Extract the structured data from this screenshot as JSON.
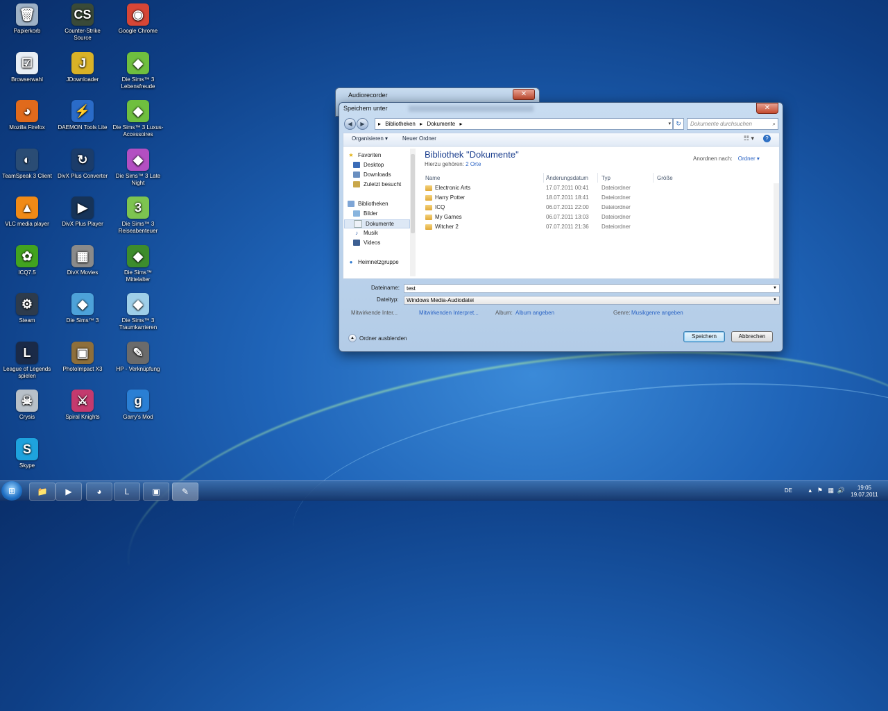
{
  "desktop": {
    "icons": [
      {
        "label": "Papierkorb",
        "icon": "recycle-bin-icon",
        "color": "#9fb2c6",
        "glyph": "🗑"
      },
      {
        "label": "Counter-Strike Source",
        "icon": "counter-strike-icon",
        "color": "#3a4a38",
        "glyph": "CS"
      },
      {
        "label": "Google Chrome",
        "icon": "chrome-icon",
        "color": "#d64636",
        "glyph": "◉"
      },
      {
        "label": "Browserwahl",
        "icon": "browser-choice-icon",
        "color": "#e8eef5",
        "glyph": "☑"
      },
      {
        "label": "JDownloader",
        "icon": "jdownloader-icon",
        "color": "#d9b227",
        "glyph": "J"
      },
      {
        "label": "Die Sims™ 3 Lebensfreude",
        "icon": "sims-icon",
        "color": "#6fbf3f",
        "glyph": "◆"
      },
      {
        "label": "Mozilla Firefox",
        "icon": "firefox-icon",
        "color": "#e06a1c",
        "glyph": "◕"
      },
      {
        "label": "DAEMON Tools Lite",
        "icon": "daemon-tools-icon",
        "color": "#2a6bc8",
        "glyph": "⚡"
      },
      {
        "label": "Die Sims™ 3 Luxus-Accessoires",
        "icon": "sims-icon",
        "color": "#6fbf3f",
        "glyph": "◆"
      },
      {
        "label": "TeamSpeak 3 Client",
        "icon": "teamspeak-icon",
        "color": "#2a4c74",
        "glyph": "◐"
      },
      {
        "label": "DivX Plus Converter",
        "icon": "divx-converter-icon",
        "color": "#1b3c6a",
        "glyph": "↻"
      },
      {
        "label": "Die Sims™ 3 Late Night",
        "icon": "sims-icon",
        "color": "#b34fc2",
        "glyph": "◆"
      },
      {
        "label": "VLC media player",
        "icon": "vlc-icon",
        "color": "#f08a16",
        "glyph": "▲"
      },
      {
        "label": "DivX Plus Player",
        "icon": "divx-player-icon",
        "color": "#163358",
        "glyph": "▶"
      },
      {
        "label": "Die Sims™ 3 Reiseabenteuer",
        "icon": "sims-icon",
        "color": "#7dc450",
        "glyph": "3"
      },
      {
        "label": "ICQ7.5",
        "icon": "icq-icon",
        "color": "#42a31f",
        "glyph": "✿"
      },
      {
        "label": "DivX Movies",
        "icon": "divx-movies-icon",
        "color": "#8a8a8a",
        "glyph": "▦"
      },
      {
        "label": "Die Sims™ Mittelalter",
        "icon": "sims-icon",
        "color": "#3d8c2c",
        "glyph": "◆"
      },
      {
        "label": "Steam",
        "icon": "steam-icon",
        "color": "#2d3b4c",
        "glyph": "⚙"
      },
      {
        "label": "Die Sims™ 3",
        "icon": "sims-icon",
        "color": "#4da2d9",
        "glyph": "◆"
      },
      {
        "label": "Die Sims™ 3 Traumkarrieren",
        "icon": "sims-icon",
        "color": "#9ecfe8",
        "glyph": "◆"
      },
      {
        "label": "League of Legends spielen",
        "icon": "league-of-legends-icon",
        "color": "#1a2a48",
        "glyph": "L"
      },
      {
        "label": "PhotoImpact X3",
        "icon": "photoimpact-icon",
        "color": "#8e6f3b",
        "glyph": "▣"
      },
      {
        "label": "HP - Verknüpfung",
        "icon": "hp-shortcut-icon",
        "color": "#6b6b6b",
        "glyph": "✎"
      },
      {
        "label": "Crysis",
        "icon": "crysis-icon",
        "color": "#b8c0c8",
        "glyph": "☠"
      },
      {
        "label": "Spiral Knights",
        "icon": "spiral-knights-icon",
        "color": "#c43a6e",
        "glyph": "⚔"
      },
      {
        "label": "Garry's Mod",
        "icon": "garrys-mod-icon",
        "color": "#2a7fd4",
        "glyph": "g"
      },
      {
        "label": "Skype",
        "icon": "skype-icon",
        "color": "#1ea2dd",
        "glyph": "S"
      }
    ]
  },
  "bg_window": {
    "title": "Audiorecorder",
    "close": "✕"
  },
  "dialog": {
    "title": "Speichern unter",
    "close": "✕",
    "breadcrumb": [
      "Bibliotheken",
      "Dokumente"
    ],
    "search_placeholder": "Dokumente durchsuchen",
    "toolbar": {
      "organize": "Organisieren ▾",
      "new_folder": "Neuer Ordner"
    },
    "nav": {
      "favorites_header": "Favoriten",
      "favorites": [
        "Desktop",
        "Downloads",
        "Zuletzt besucht"
      ],
      "libraries_header": "Bibliotheken",
      "libraries": [
        "Bilder",
        "Dokumente",
        "Musik",
        "Videos"
      ],
      "homegroup": "Heimnetzgruppe"
    },
    "library": {
      "title": "Bibliothek \"Dokumente\"",
      "sub_label": "Hierzu gehören:",
      "sub_link": "2 Orte",
      "sort_label": "Anordnen nach:",
      "sort_value": "Ordner ▾"
    },
    "columns": [
      "Name",
      "Änderungsdatum",
      "Typ",
      "Größe"
    ],
    "files": [
      {
        "name": "Electronic Arts",
        "date": "17.07.2011 00:41",
        "type": "Dateiordner"
      },
      {
        "name": "Harry Potter",
        "date": "18.07.2011 18:41",
        "type": "Dateiordner"
      },
      {
        "name": "ICQ",
        "date": "06.07.2011 22:00",
        "type": "Dateiordner"
      },
      {
        "name": "My Games",
        "date": "06.07.2011 13:03",
        "type": "Dateiordner"
      },
      {
        "name": "Witcher 2",
        "date": "07.07.2011 21:36",
        "type": "Dateiordner"
      }
    ],
    "form": {
      "filename_label": "Dateiname:",
      "filename_value": "test",
      "filetype_label": "Dateityp:",
      "filetype_value": "Windows Media-Audiodatei",
      "artists_label": "Mitwirkende Inter...",
      "artists_value": "Mitwirkenden Interpret...",
      "album_label": "Album:",
      "album_value": "Album angeben",
      "genre_label": "Genre:",
      "genre_value": "Musikgenre angeben"
    },
    "footer": {
      "hide_folders": "Ordner ausblenden",
      "save": "Speichern",
      "cancel": "Abbrechen"
    }
  },
  "taskbar": {
    "lang": "DE",
    "time": "19:05",
    "date": "19.07.2011"
  }
}
